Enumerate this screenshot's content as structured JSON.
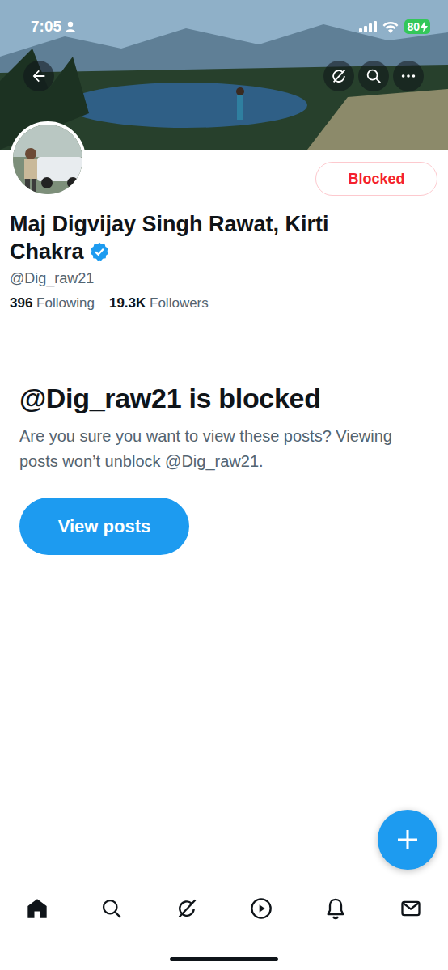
{
  "status_bar": {
    "time": "7:05",
    "battery": "80",
    "charging": true
  },
  "profile": {
    "name": "Maj Digvijay Singh Rawat, Kirti Chakra",
    "verified": true,
    "handle": "@Dig_raw21",
    "following_count": "396",
    "following_label": "Following",
    "followers_count": "19.3K",
    "followers_label": "Followers"
  },
  "block_button": {
    "label": "Blocked"
  },
  "blocked_notice": {
    "title": "@Dig_raw21 is blocked",
    "message": "Are you sure you want to view these posts? Viewing posts won’t unblock @Dig_raw21.",
    "button": "View posts"
  },
  "nav": [
    {
      "selected": true
    },
    {
      "selected": false
    },
    {
      "selected": false
    },
    {
      "selected": false
    },
    {
      "selected": false
    },
    {
      "selected": false
    }
  ]
}
